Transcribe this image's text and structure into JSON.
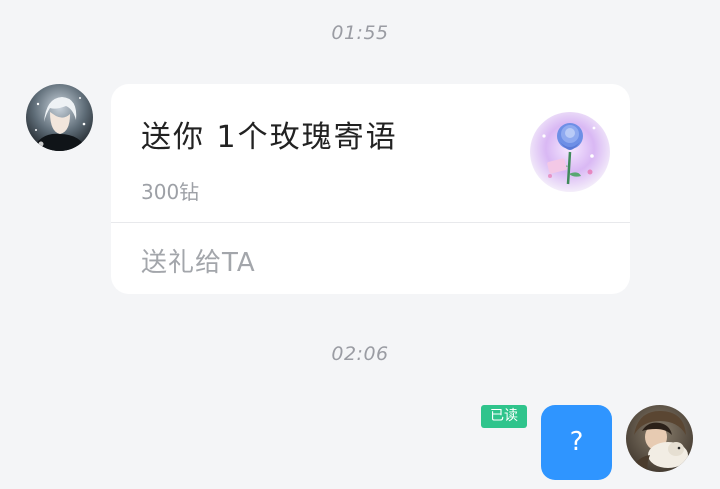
{
  "timestamps": [
    "01:55",
    "02:06"
  ],
  "incoming": {
    "avatar_icon": "anime-avatar-icon",
    "gift_card": {
      "title": "送你 1个玫瑰寄语",
      "price": "300钻",
      "action": "送礼给TA",
      "gift_icon": "rose-gift-icon"
    }
  },
  "outgoing": {
    "read_status": "已读",
    "message_text": "?",
    "avatar_icon": "user-photo-avatar-icon"
  },
  "colors": {
    "background": "#f4f5f7",
    "bubble_blue": "#2f95ff",
    "read_green": "#2fc48c"
  }
}
